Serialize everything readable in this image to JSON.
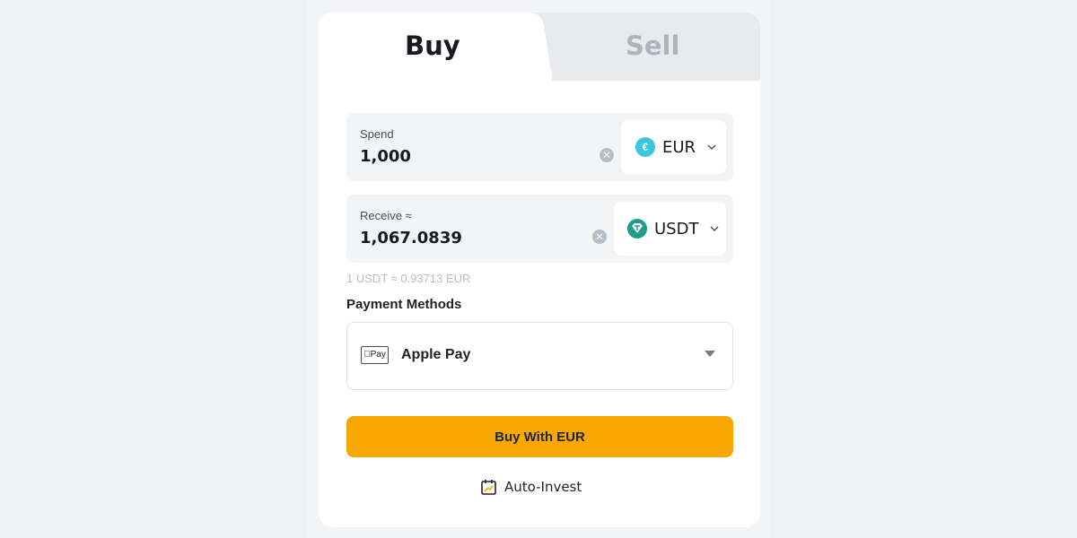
{
  "tabs": [
    {
      "label": "Buy",
      "active": true
    },
    {
      "label": "Sell",
      "active": false
    }
  ],
  "spend": {
    "label": "Spend",
    "value": "1,000",
    "currency": {
      "code": "EUR",
      "icon": "euro-coin-icon",
      "symbol": "€",
      "color": "#3ac5e0"
    }
  },
  "receive": {
    "label": "Receive ≈",
    "value": "1,067.0839",
    "currency": {
      "code": "USDT",
      "icon": "tether-coin-icon",
      "color": "#1c9e8a"
    }
  },
  "rate": "1 USDT ≈ 0.93713 EUR",
  "payment": {
    "label": "Payment Methods",
    "selected": "Apple Pay",
    "icon_text": "Pay"
  },
  "buy_button": {
    "label": "Buy With EUR",
    "color": "#f8a803"
  },
  "auto_invest": {
    "label": "Auto-Invest"
  }
}
